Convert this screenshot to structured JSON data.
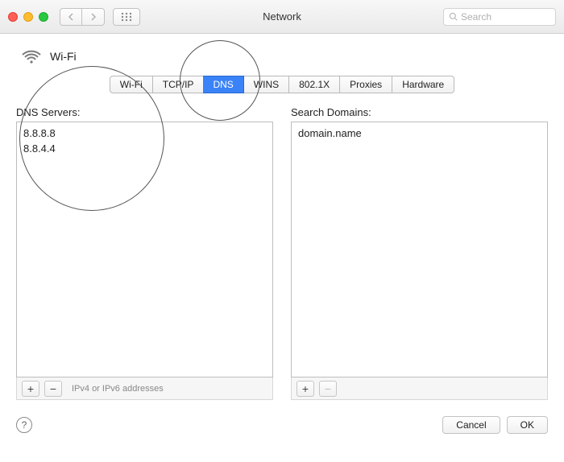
{
  "window": {
    "title": "Network"
  },
  "search": {
    "placeholder": "Search"
  },
  "wifi": {
    "label": "Wi-Fi"
  },
  "tabs": {
    "items": [
      {
        "label": "Wi-Fi"
      },
      {
        "label": "TCP/IP"
      },
      {
        "label": "DNS",
        "active": true
      },
      {
        "label": "WINS"
      },
      {
        "label": "802.1X"
      },
      {
        "label": "Proxies"
      },
      {
        "label": "Hardware"
      }
    ]
  },
  "dns_panel": {
    "label": "DNS Servers:",
    "items": [
      "8.8.8.8",
      "8.8.4.4"
    ],
    "hint": "IPv4 or IPv6 addresses"
  },
  "domains_panel": {
    "label": "Search Domains:",
    "items": [
      "domain.name"
    ]
  },
  "buttons": {
    "add": "+",
    "remove": "−",
    "cancel": "Cancel",
    "ok": "OK",
    "help": "?"
  }
}
